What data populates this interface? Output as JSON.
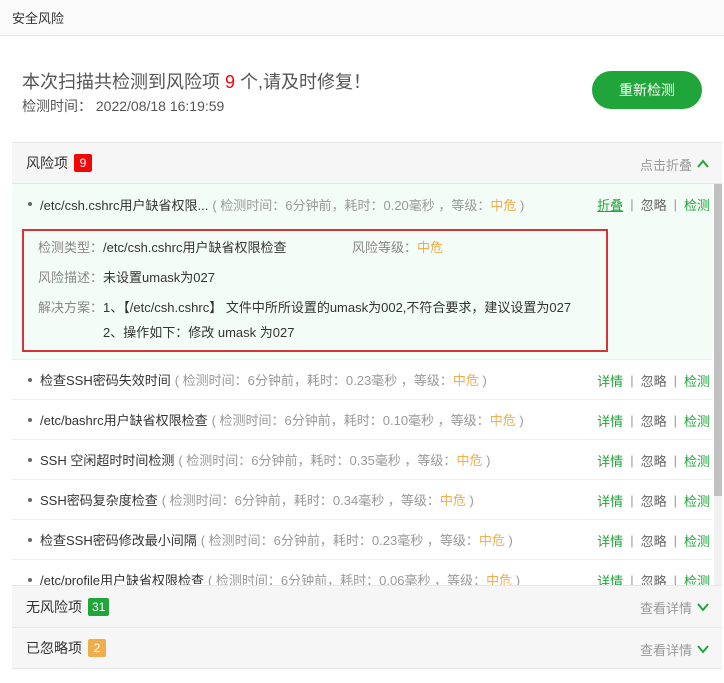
{
  "topbar": {
    "title": "安全风险"
  },
  "summary": {
    "title_prefix": "本次扫描共检测到风险项 ",
    "count": "9",
    "title_suffix": " 个,请及时修复！",
    "time_label": "检测时间：",
    "time_value": "2022/08/18 16:19:59",
    "rescan_label": "重新检测"
  },
  "risk_section": {
    "title": "风险项",
    "count": "9",
    "action": "点击折叠"
  },
  "risks": [
    {
      "name": "/etc/csh.cshrc用户缺省权限...",
      "meta_prefix": "( 检测时间：6分钟前，耗时：0.20毫秒 ，等级：",
      "level": "中危",
      "meta_suffix": " )",
      "first_action": "折叠",
      "ignore": "忽略",
      "check": "检测"
    },
    {
      "name": "检查SSH密码失效时间",
      "meta_prefix": "( 检测时间：6分钟前，耗时：0.23毫秒 ，等级：",
      "level": "中危",
      "meta_suffix": " )",
      "first_action": "详情",
      "ignore": "忽略",
      "check": "检测"
    },
    {
      "name": "/etc/bashrc用户缺省权限检查",
      "meta_prefix": "( 检测时间：6分钟前，耗时：0.10毫秒 ，等级：",
      "level": "中危",
      "meta_suffix": " )",
      "first_action": "详情",
      "ignore": "忽略",
      "check": "检测"
    },
    {
      "name": "SSH 空闲超时时间检测",
      "meta_prefix": "( 检测时间：6分钟前，耗时：0.35毫秒 ，等级：",
      "level": "中危",
      "meta_suffix": " )",
      "first_action": "详情",
      "ignore": "忽略",
      "check": "检测"
    },
    {
      "name": "SSH密码复杂度检查",
      "meta_prefix": "( 检测时间：6分钟前，耗时：0.34毫秒 ，等级：",
      "level": "中危",
      "meta_suffix": " )",
      "first_action": "详情",
      "ignore": "忽略",
      "check": "检测"
    },
    {
      "name": "检查SSH密码修改最小间隔",
      "meta_prefix": "( 检测时间：6分钟前，耗时：0.23毫秒 ，等级：",
      "level": "中危",
      "meta_suffix": " )",
      "first_action": "详情",
      "ignore": "忽略",
      "check": "检测"
    },
    {
      "name": "/etc/profile用户缺省权限检查",
      "meta_prefix": "( 检测时间：6分钟前，耗时：0.06毫秒 ，等级：",
      "level": "中危",
      "meta_suffix": " )",
      "first_action": "详情",
      "ignore": "忽略",
      "check": "检测"
    }
  ],
  "detail": {
    "type_label": "检测类型：",
    "type_value": "/etc/csh.cshrc用户缺省权限检查",
    "level_label": "风险等级：",
    "level_value": "中危",
    "desc_label": "风险描述：",
    "desc_value": "未设置umask为027",
    "solution_label": "解决方案：",
    "solution_1": "1、【/etc/csh.cshrc】 文件中所所设置的umask为002,不符合要求，建议设置为027",
    "solution_2": "2、操作如下：修改 umask 为027"
  },
  "safe_section": {
    "title": "无风险项",
    "count": "31",
    "action": "查看详情"
  },
  "ignored_section": {
    "title": "已忽略项",
    "count": "2",
    "action": "查看详情"
  },
  "colors": {
    "accent": "#20a53a",
    "danger": "#ef0808",
    "warning": "#f0ad4e"
  }
}
